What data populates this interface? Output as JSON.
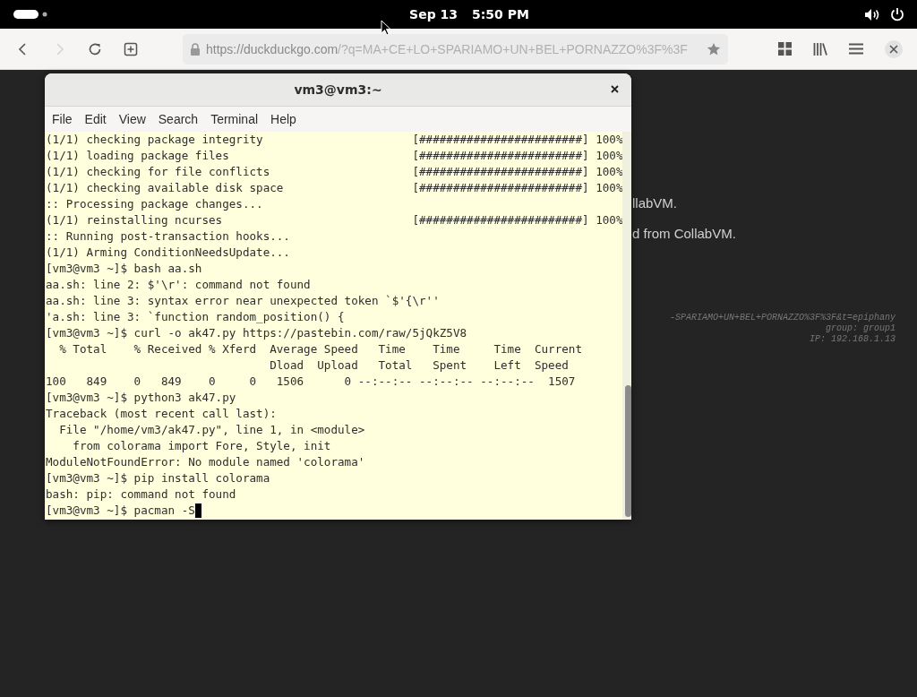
{
  "top_bar": {
    "date": "Sep 13",
    "time": "5:50 PM"
  },
  "browser": {
    "toolbar": [
      {
        "kind": "back",
        "disabled": false
      },
      {
        "kind": "forward",
        "disabled": true
      },
      {
        "kind": "reload",
        "disabled": false
      },
      {
        "kind": "new-tab",
        "disabled": false
      }
    ],
    "url": {
      "host": "https://duckduckgo.com",
      "rest": "/?q=MA+CE+LO+SPARIAMO+UN+BEL+PORNAZZO%3F%3F"
    }
  },
  "page": {
    "lines": [
      "llabVM.",
      "d from CollabVM."
    ],
    "info": [
      "-SPARIAMO+UN+BEL+PORNAZZO%3F%3F&t=epiphany",
      "group: group1",
      "IP: 192.168.1.13"
    ]
  },
  "terminal": {
    "title": "vm3@vm3:~",
    "menu": [
      "File",
      "Edit",
      "View",
      "Search",
      "Terminal",
      "Help"
    ],
    "lines": [
      "(1/1) checking package integrity                      [########################] 100%",
      "(1/1) loading package files                           [########################] 100%",
      "(1/1) checking for file conflicts                     [########################] 100%",
      "(1/1) checking available disk space                   [########################] 100%",
      ":: Processing package changes...",
      "(1/1) reinstalling ncurses                            [########################] 100%",
      ":: Running post-transaction hooks...",
      "(1/1) Arming ConditionNeedsUpdate...",
      "[vm3@vm3 ~]$ bash aa.sh",
      "aa.sh: line 2: $'\\r': command not found",
      "aa.sh: line 3: syntax error near unexpected token `$'{\\r''",
      "'a.sh: line 3: `function random_position() {",
      "[vm3@vm3 ~]$ curl -o ak47.py https://pastebin.com/raw/5jQkZ5V8",
      "  % Total    % Received % Xferd  Average Speed   Time    Time     Time  Current",
      "                                 Dload  Upload   Total   Spent    Left  Speed",
      "100   849    0   849    0     0   1506      0 --:--:-- --:--:-- --:--:--  1507",
      "[vm3@vm3 ~]$ python3 ak47.py",
      "Traceback (most recent call last):",
      "  File \"/home/vm3/ak47.py\", line 1, in <module>",
      "    from colorama import Fore, Style, init",
      "ModuleNotFoundError: No module named 'colorama'",
      "[vm3@vm3 ~]$ pip install colorama",
      "bash: pip: command not found",
      "[vm3@vm3 ~]$ pacman -S"
    ]
  }
}
